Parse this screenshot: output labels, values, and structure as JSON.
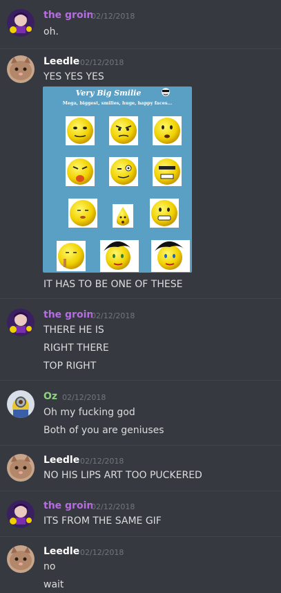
{
  "users": {
    "groin": {
      "name": "the groin",
      "color": "#b56ee0"
    },
    "leedle": {
      "name": "Leedle",
      "color": "#ffffff"
    },
    "oz": {
      "name": "Oz",
      "color": "#8ed081"
    }
  },
  "messages": [
    {
      "author": "the groin",
      "timestamp": "02/12/2018",
      "lines": [
        "oh."
      ]
    },
    {
      "author": "Leedle",
      "timestamp": "02/12/2018",
      "lines": [
        "YES YES YES",
        "IT HAS TO BE ONE OF THESE"
      ]
    },
    {
      "author": "the groin",
      "timestamp": "02/12/2018",
      "lines": [
        "THERE HE IS",
        "RIGHT THERE",
        "TOP RIGHT"
      ]
    },
    {
      "author": "Oz",
      "timestamp": "02/12/2018",
      "lines": [
        "Oh my fucking god",
        "Both of you are geniuses"
      ]
    },
    {
      "author": "Leedle",
      "timestamp": "02/12/2018",
      "lines": [
        "NO HIS LIPS ART TOO PUCKERED"
      ]
    },
    {
      "author": "the groin",
      "timestamp": "02/12/2018",
      "lines": [
        "ITS FROM THE SAME GIF"
      ]
    },
    {
      "author": "Leedle",
      "timestamp": "02/12/2018",
      "lines": [
        "no",
        "wait"
      ]
    }
  ],
  "attachment": {
    "title": "Very Big Smilie",
    "subtitle": "Mega, biggest, smilies, huge, happy faces..."
  }
}
